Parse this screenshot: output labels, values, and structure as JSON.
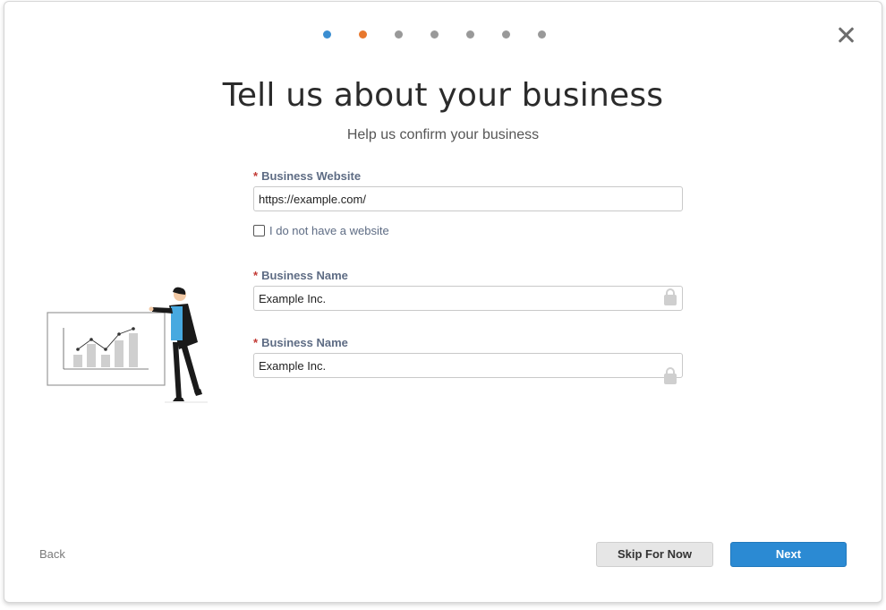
{
  "colors": {
    "accent": "#2b8ad3",
    "step_done": "#3b8ed1",
    "step_current": "#e8782e",
    "step_pending": "#999999",
    "required": "#c23934",
    "label": "#5e6c84"
  },
  "stepper": {
    "total_steps": 7,
    "completed_steps": 1,
    "current_step": 2
  },
  "close_icon": "close-icon",
  "header": {
    "title": "Tell us about your business",
    "subtitle": "Help us confirm your business"
  },
  "form": {
    "required_marker": "*",
    "website": {
      "label": "Business Website",
      "value": "https://example.com/"
    },
    "no_website": {
      "label": "I do not have a website",
      "checked": false
    },
    "business_name_1": {
      "label": "Business Name",
      "value": "Example Inc.",
      "icon": "lock-icon"
    },
    "business_name_2": {
      "label": "Business Name",
      "value": "Example Inc.",
      "icon": "lock-icon"
    }
  },
  "illustration": "person-presenting-chart-illustration",
  "footer": {
    "back_label": "Back",
    "skip_label": "Skip For Now",
    "next_label": "Next"
  }
}
